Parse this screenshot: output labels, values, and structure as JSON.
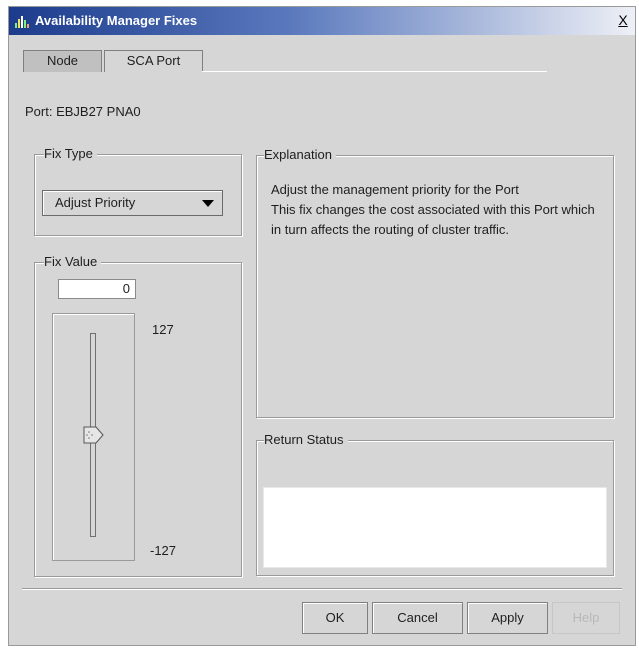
{
  "window": {
    "title": "Availability Manager Fixes",
    "close_label": "X"
  },
  "tabs": [
    {
      "label": "Node",
      "active": true
    },
    {
      "label": "SCA Port",
      "active": false
    }
  ],
  "port": {
    "label": "Port: EBJB27 PNA0"
  },
  "fix_type": {
    "title": "Fix Type",
    "selected": "Adjust Priority"
  },
  "fix_value": {
    "title": "Fix Value",
    "value": "0",
    "max_label": "127",
    "min_label": "-127",
    "level_fraction": 0.5
  },
  "explanation": {
    "title": "Explanation",
    "line1": "Adjust the management priority for the Port",
    "line2": "This fix changes the cost associated with this Port which in turn affects the routing of cluster traffic."
  },
  "return_status": {
    "title": "Return Status",
    "text": ""
  },
  "buttons": {
    "ok": "OK",
    "cancel": "Cancel",
    "apply": "Apply",
    "help": "Help"
  },
  "colors": {
    "title_bar_start": "#1c3b8c",
    "dialog_bg": "#d6d6d6"
  }
}
